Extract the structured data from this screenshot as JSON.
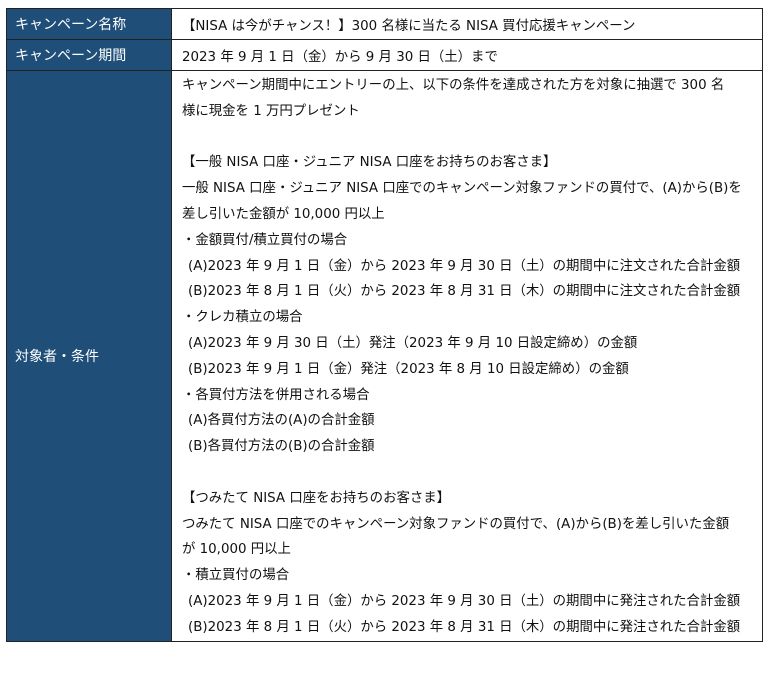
{
  "rows": {
    "name": {
      "label": "キャンペーン名称",
      "value": "【NISA は今がチャンス！】300 名様に当たる NISA 買付応援キャンペーン"
    },
    "period": {
      "label": "キャンペーン期間",
      "value": "2023 年 9 月 1 日（金）から 9 月 30 日（土）まで"
    },
    "conditions": {
      "label": "対象者・条件",
      "lines": [
        "キャンペーン期間中にエントリーの上、以下の条件を達成された方を対象に抽選で 300 名",
        "様に現金を 1 万円プレゼント",
        "",
        "【一般 NISA 口座・ジュニア NISA 口座をお持ちのお客さま】",
        "一般 NISA 口座・ジュニア NISA 口座でのキャンペーン対象ファンドの買付で、(A)から(B)を",
        "差し引いた金額が 10,000 円以上",
        "・金額買付/積立買付の場合",
        "(A)2023 年 9 月 1 日（金）から 2023 年 9 月 30 日（土）の期間中に注文された合計金額",
        "(B)2023 年 8 月 1 日（火）から 2023 年 8 月 31 日（木）の期間中に注文された合計金額",
        "・クレカ積立の場合",
        "(A)2023 年 9 月 30 日（土）発注（2023 年 9 月 10 日設定締め）の金額",
        "(B)2023 年 9 月 1 日（金）発注（2023 年 8 月 10 日設定締め）の金額",
        "・各買付方法を併用される場合",
        "(A)各買付方法の(A)の合計金額",
        "(B)各買付方法の(B)の合計金額",
        "",
        "【つみたて NISA 口座をお持ちのお客さま】",
        "つみたて NISA 口座でのキャンペーン対象ファンドの買付で、(A)から(B)を差し引いた金額",
        "が 10,000 円以上",
        "・積立買付の場合",
        "(A)2023 年 9 月 1 日（金）から 2023 年 9 月 30 日（土）の期間中に発注された合計金額",
        "(B)2023 年 8 月 1 日（火）から 2023 年 8 月 31 日（木）の期間中に発注された合計金額"
      ]
    }
  }
}
